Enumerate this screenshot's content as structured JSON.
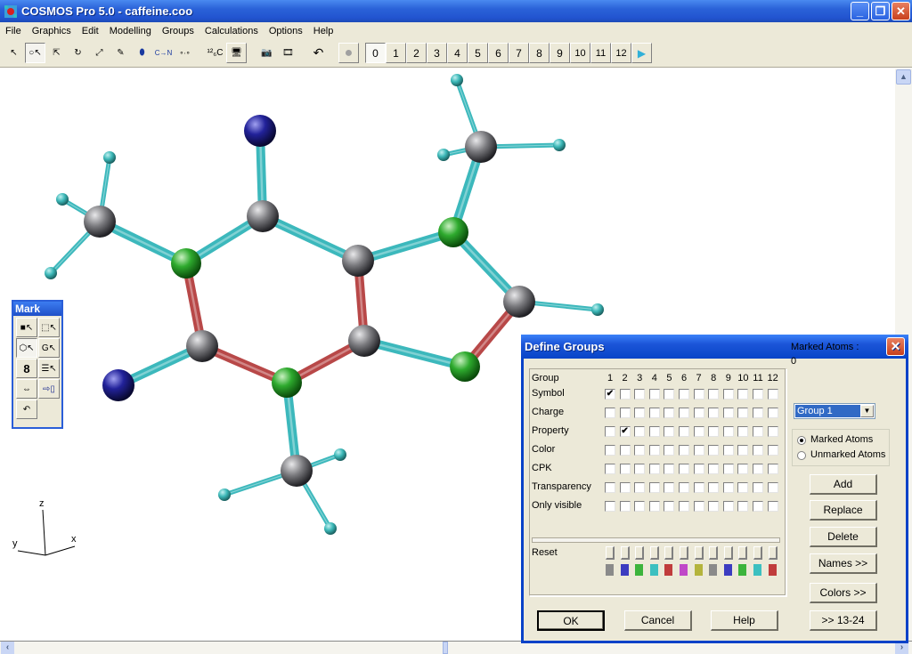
{
  "window": {
    "title": "COSMOS Pro 5.0 - caffeine.coo",
    "controls": {
      "minimize": "_",
      "restore": "❐",
      "close": "✕"
    }
  },
  "menu": [
    "File",
    "Graphics",
    "Edit",
    "Modelling",
    "Groups",
    "Calculations",
    "Options",
    "Help"
  ],
  "toolbar": {
    "tools": [
      {
        "name": "select-measure-tool",
        "glyph": "↖"
      },
      {
        "name": "select-atom-tool",
        "glyph": "○↖"
      },
      {
        "name": "translate-tool",
        "glyph": "⇱"
      },
      {
        "name": "rotate-tool",
        "glyph": "↻"
      },
      {
        "name": "zoom-tool",
        "glyph": "⤢"
      },
      {
        "name": "draw-bond-tool",
        "glyph": "✎"
      },
      {
        "name": "eraser-tool",
        "glyph": "⬮"
      },
      {
        "name": "element-change-tool",
        "glyph": "C→N"
      },
      {
        "name": "dotted-bond-tool",
        "glyph": "∘∙∘"
      },
      {
        "name": "isotope-tool",
        "glyph": "¹²₆C"
      },
      {
        "name": "display-tool",
        "glyph": "🖥"
      },
      {
        "name": "camera-tool",
        "glyph": "📷"
      },
      {
        "name": "film-tool",
        "glyph": "🎞"
      },
      {
        "name": "undo-tool",
        "glyph": "↶"
      },
      {
        "name": "stop-tool",
        "glyph": "●"
      }
    ],
    "frames": [
      "0",
      "1",
      "2",
      "3",
      "4",
      "5",
      "6",
      "7",
      "8",
      "9",
      "10",
      "11",
      "12"
    ],
    "selected_frame": "0",
    "next_glyph": "▶"
  },
  "axes": {
    "z": "z",
    "y": "y",
    "x": "x"
  },
  "mark_palette": {
    "title": "Mark",
    "buttons": [
      {
        "name": "mark-atom",
        "glyph": "■↖"
      },
      {
        "name": "mark-rectangle",
        "glyph": "⬚↖"
      },
      {
        "name": "mark-ring",
        "glyph": "⬡↖"
      },
      {
        "name": "mark-group",
        "glyph": "G↖"
      },
      {
        "name": "mark-chain",
        "glyph": "8"
      },
      {
        "name": "mark-list",
        "glyph": "☰↖"
      },
      {
        "name": "mark-swap",
        "glyph": "⇔"
      },
      {
        "name": "mark-invert",
        "glyph": "⇨▯"
      },
      {
        "name": "mark-undo",
        "glyph": "↶"
      }
    ]
  },
  "dialog": {
    "title": "Define Groups",
    "close": "✕",
    "header_label": "Group",
    "columns": [
      "1",
      "2",
      "3",
      "4",
      "5",
      "6",
      "7",
      "8",
      "9",
      "10",
      "11",
      "12"
    ],
    "rows": [
      {
        "label": "Symbol",
        "checked": [
          true,
          false,
          false,
          false,
          false,
          false,
          false,
          false,
          false,
          false,
          false,
          false
        ]
      },
      {
        "label": "Charge",
        "checked": [
          false,
          false,
          false,
          false,
          false,
          false,
          false,
          false,
          false,
          false,
          false,
          false
        ]
      },
      {
        "label": "Property",
        "checked": [
          false,
          true,
          false,
          false,
          false,
          false,
          false,
          false,
          false,
          false,
          false,
          false
        ]
      },
      {
        "label": "Color",
        "checked": [
          false,
          false,
          false,
          false,
          false,
          false,
          false,
          false,
          false,
          false,
          false,
          false
        ]
      },
      {
        "label": "CPK",
        "checked": [
          false,
          false,
          false,
          false,
          false,
          false,
          false,
          false,
          false,
          false,
          false,
          false
        ]
      },
      {
        "label": "Transparency",
        "checked": [
          false,
          false,
          false,
          false,
          false,
          false,
          false,
          false,
          false,
          false,
          false,
          false
        ]
      },
      {
        "label": "Only visible",
        "checked": [
          false,
          false,
          false,
          false,
          false,
          false,
          false,
          false,
          false,
          false,
          false,
          false
        ]
      }
    ],
    "reset_label": "Reset",
    "group_colors": [
      "#8a8a8a",
      "#3c3cc0",
      "#3cb43c",
      "#3cc0c0",
      "#c03c3c",
      "#c048c8",
      "#b4b43c",
      "#8a8a8a",
      "#3c3cc0",
      "#3cb43c",
      "#3cc0c0",
      "#c03c3c"
    ],
    "marked_atoms_label": "Marked Atoms :",
    "marked_atoms_count": "0",
    "group_select": "Group 1",
    "radio": {
      "marked": "Marked Atoms",
      "unmarked": "Unmarked Atoms",
      "selected": "marked"
    },
    "buttons": {
      "add": "Add",
      "replace": "Replace",
      "delete": "Delete",
      "names": "Names >>",
      "colors": "Colors >>",
      "more": ">> 13-24",
      "ok": "OK",
      "cancel": "Cancel",
      "help": "Help"
    }
  },
  "molecule": {
    "name": "caffeine",
    "colors": {
      "carbon": "#7a7a7e",
      "nitrogen": "#2eaa2e",
      "oxygen": "#22229a",
      "hydrogen": "#3cb8b8",
      "bond": "#3cb8bc",
      "double_bond": "#b84848"
    }
  }
}
